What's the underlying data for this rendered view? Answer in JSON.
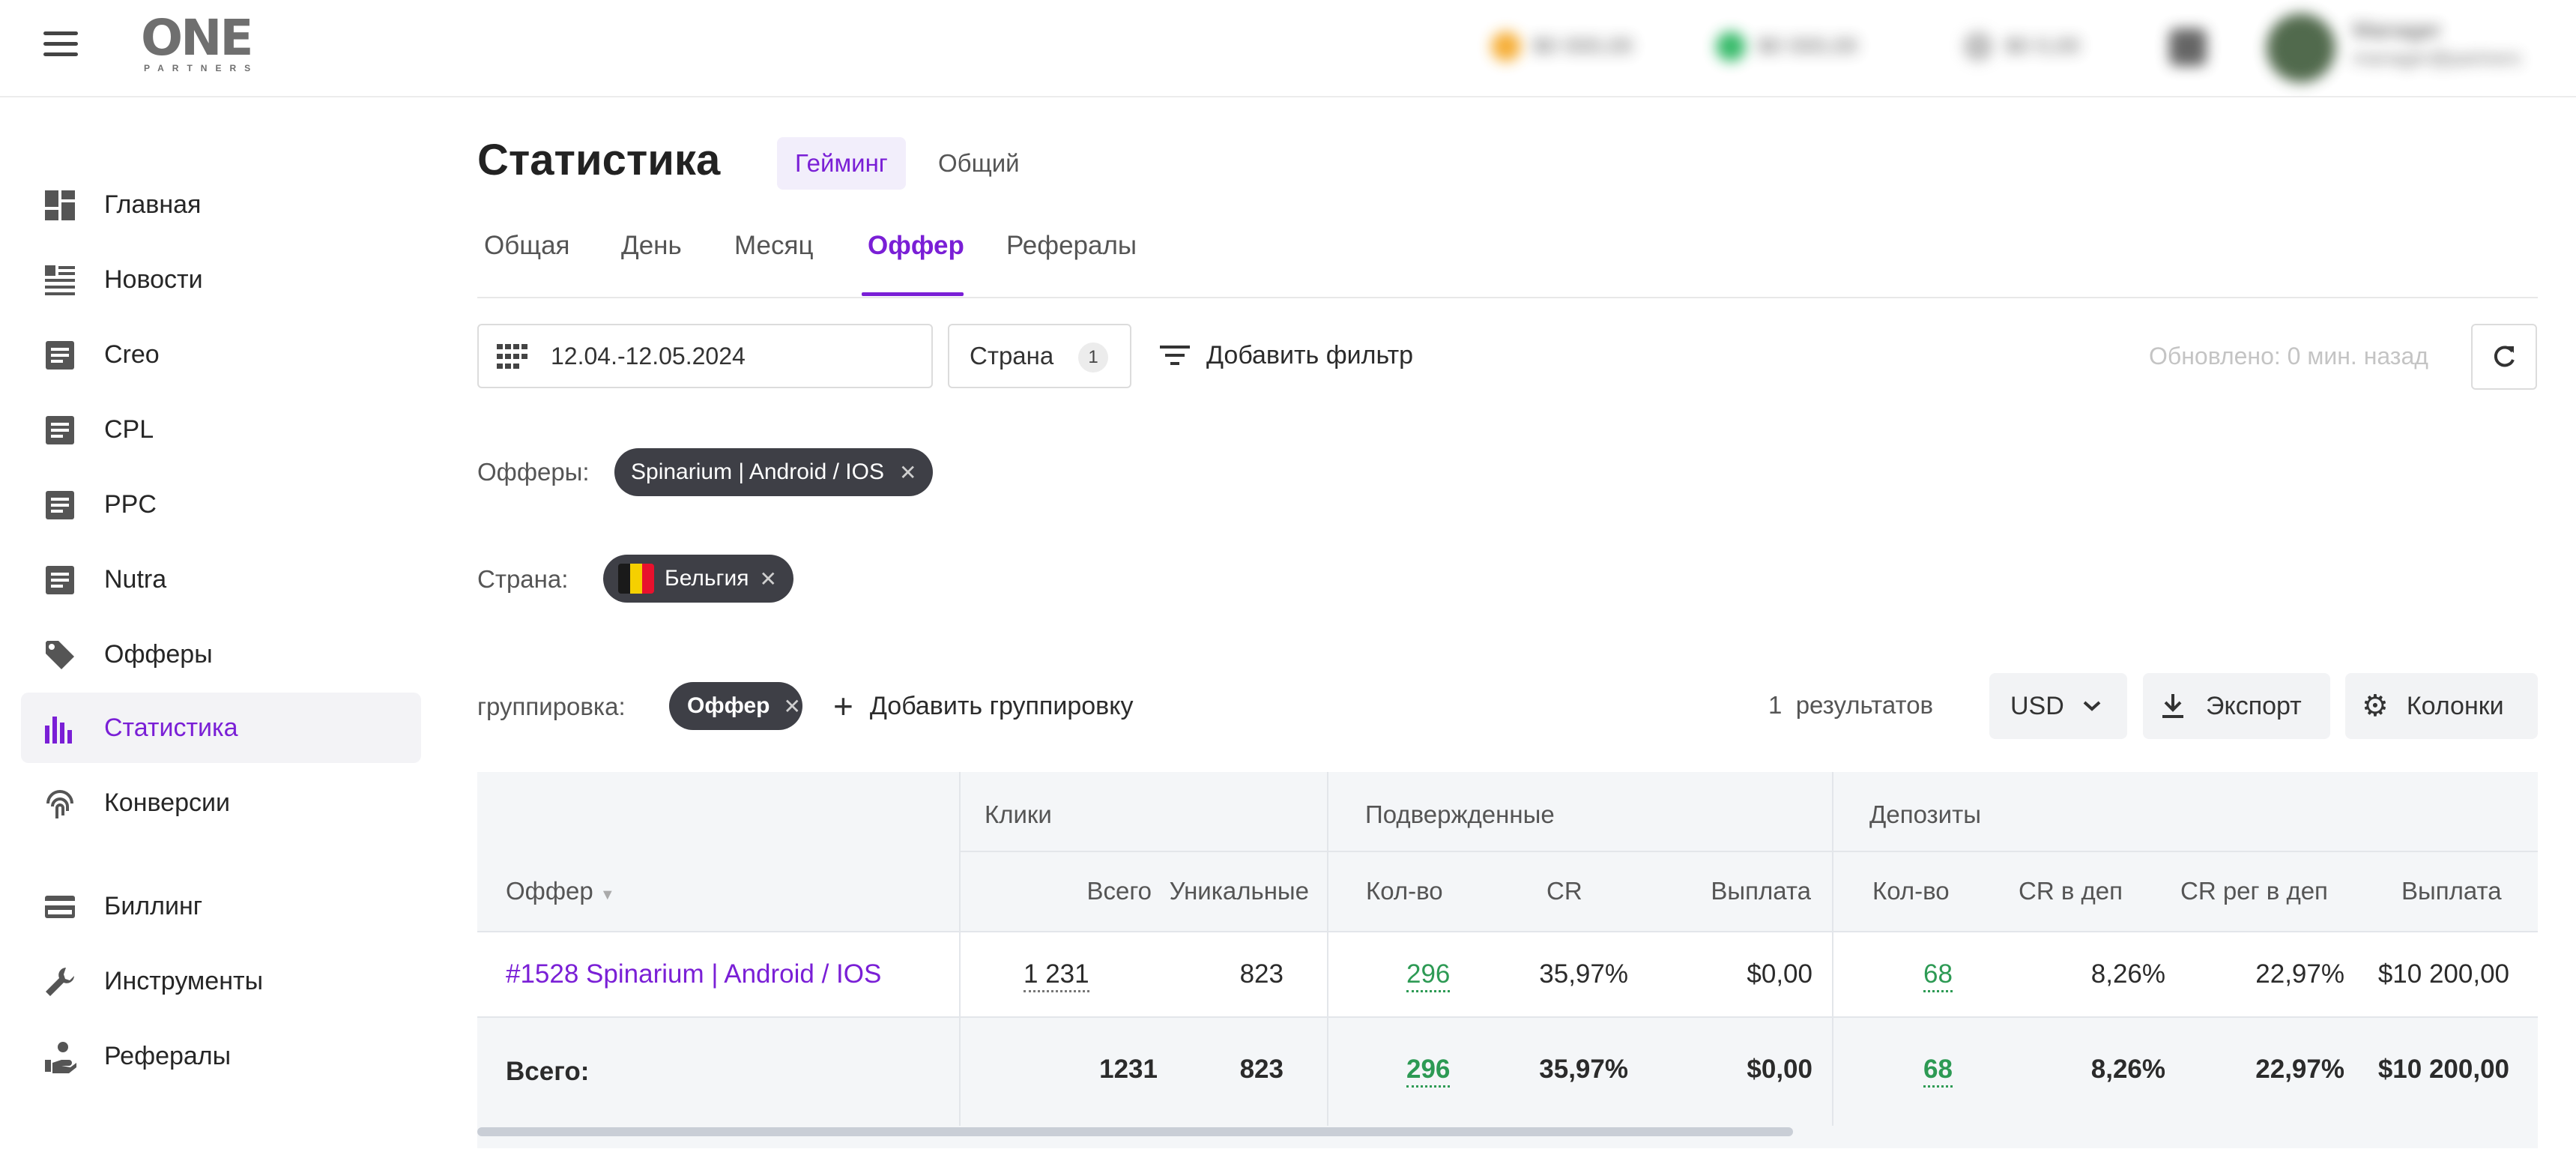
{
  "header": {
    "logo_main": "ONE",
    "logo_sub": "PARTNERS",
    "balances": [
      {
        "text": "$0 000,00",
        "color": "#f5a623"
      },
      {
        "text": "$0 000,00",
        "color": "#22b35a"
      },
      {
        "text": "$0 0,00",
        "color": "#bbbbbb"
      }
    ],
    "user": {
      "name": "Manager",
      "subtitle": "manager@partners"
    }
  },
  "sidebar": {
    "items": [
      {
        "label": "Главная",
        "icon": "dashboard-icon"
      },
      {
        "label": "Новости",
        "icon": "news-icon"
      },
      {
        "label": "Creo",
        "icon": "document-icon"
      },
      {
        "label": "CPL",
        "icon": "document-icon"
      },
      {
        "label": "PPC",
        "icon": "document-icon"
      },
      {
        "label": "Nutra",
        "icon": "document-icon"
      },
      {
        "label": "Офферы",
        "icon": "tag-icon"
      },
      {
        "label": "Статистика",
        "icon": "bar-chart-icon",
        "active": true
      },
      {
        "label": "Конверсии",
        "icon": "fingerprint-icon"
      },
      {
        "label": "Биллинг",
        "icon": "credit-card-icon"
      },
      {
        "label": "Инструменты",
        "icon": "wrench-icon"
      },
      {
        "label": "Рефералы",
        "icon": "referral-icon"
      }
    ]
  },
  "page": {
    "title": "Статистика",
    "type_tabs": [
      "Гейминг",
      "Общий"
    ],
    "tabs": [
      "Общая",
      "День",
      "Месяц",
      "Оффер",
      "Рефералы"
    ],
    "active_tab": "Оффер"
  },
  "filters": {
    "date_range": "12.04.-12.05.2024",
    "country_label": "Страна",
    "country_count": "1",
    "add_filter": "Добавить фильтр",
    "updated": "Обновлено: 0 мин. назад",
    "offers_label": "Офферы:",
    "offer_chip": "Spinarium | Android / IOS",
    "country_row_label": "Страна:",
    "country_chip": "Бельгия",
    "flag_colors": [
      "#1a1a1a",
      "#f5d000",
      "#e8112d"
    ]
  },
  "grouping": {
    "label": "группировка:",
    "chip": "Оффер",
    "add": "Добавить группировку",
    "results_count": "1",
    "results_text": "результатов",
    "currency": "USD",
    "export": "Экспорт",
    "columns": "Колонки"
  },
  "table": {
    "groups": [
      "Клики",
      "Подвержденные",
      "Депозиты"
    ],
    "columns": {
      "offer": "Оффер",
      "clicks_total": "Всего",
      "clicks_unique": "Уникальные",
      "conf_count": "Кол-во",
      "conf_cr": "CR",
      "conf_payout": "Выплата",
      "dep_count": "Кол-во",
      "dep_cr": "CR в деп",
      "dep_cr_reg": "CR рег в деп",
      "dep_payout": "Выплата"
    },
    "row": {
      "offer": "#1528 Spinarium | Android / IOS",
      "clicks_total": "1 231",
      "clicks_unique": "823",
      "conf_count": "296",
      "conf_cr": "35,97%",
      "conf_payout": "$0,00",
      "dep_count": "68",
      "dep_cr": "8,26%",
      "dep_cr_reg": "22,97%",
      "dep_payout": "$10 200,00"
    },
    "total": {
      "label": "Всего:",
      "clicks_total": "1231",
      "clicks_unique": "823",
      "conf_count": "296",
      "conf_cr": "35,97%",
      "conf_payout": "$0,00",
      "dep_count": "68",
      "dep_cr": "8,26%",
      "dep_cr_reg": "22,97%",
      "dep_payout": "$10 200,00"
    }
  },
  "colors": {
    "accent": "#7a1fd6",
    "positive": "#2d9a54",
    "chip_bg": "#3e3f46"
  }
}
